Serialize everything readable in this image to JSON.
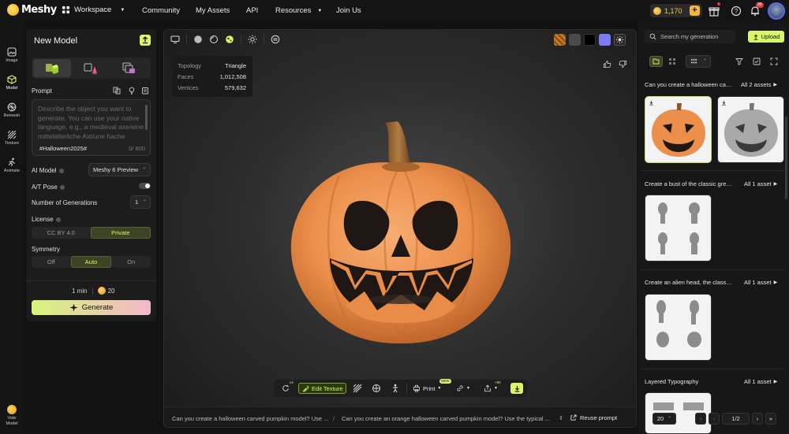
{
  "topbar": {
    "logo": "Meshy",
    "workspace": "Workspace",
    "nav": [
      "Community",
      "My Assets",
      "API",
      "Resources",
      "Join Us"
    ],
    "credits": "1,170",
    "notif_count": "99"
  },
  "leftnav": {
    "items": [
      "Image",
      "Model",
      "Remesh",
      "Texture",
      "Animate"
    ],
    "vote": "Vote Model"
  },
  "panel": {
    "title": "New Model",
    "prompt_label": "Prompt",
    "prompt_placeholder": "Describe the object you want to generate. You can use your native language, e.g., a medieval axe/eine mittelalterliche Axt/une hache",
    "prompt_tag": "#Halloween2025#",
    "prompt_count": "0/ 800",
    "ai_model_label": "AI Model",
    "ai_model_value": "Meshy 6 Preview",
    "at_pose_label": "A/T Pose",
    "num_gen_label": "Number of Generations",
    "num_gen_value": "1",
    "license_label": "License",
    "license_options": [
      "CC BY 4.0",
      "Private"
    ],
    "license_selected": "Private",
    "symmetry_label": "Symmetry",
    "symmetry_options": [
      "Off",
      "Auto",
      "On"
    ],
    "symmetry_selected": "Auto",
    "time": "1 min",
    "cost": "20",
    "generate": "Generate"
  },
  "viewport": {
    "stats": [
      {
        "k": "Topology",
        "v": "Triangle"
      },
      {
        "k": "Faces",
        "v": "1,012,508"
      },
      {
        "k": "Vertices",
        "v": "579,632"
      }
    ],
    "swatch_colors": [
      "#c27a2a",
      "#4a4a4a",
      "#000000",
      "#7c7bf2"
    ],
    "toolbar": {
      "retry_count": "x4",
      "edit_texture": "Edit Texture",
      "print": "Print",
      "print_badge": "NEW",
      "export_count": "+50"
    },
    "history": [
      "Can you create a halloween carved pumpkin model? Use ...",
      "Can you create an orange halloween carved pumpkin model? Use the typical ..."
    ],
    "reuse": "Reuse prompt"
  },
  "rpanel": {
    "search_placeholder": "Search my generation",
    "upload": "Upload",
    "groups": [
      {
        "title": "Can you create a halloween carved pumpkin model?",
        "all": "All 2 assets"
      },
      {
        "title": "Create a bust of the classic grey alien",
        "all": "All 1 asset"
      },
      {
        "title": "Create an alien head, the classic grey alien",
        "all": "All 1 asset"
      },
      {
        "title": "Layered Typography",
        "all": "All 1 asset"
      }
    ],
    "page_size": "20",
    "page": "1/2"
  }
}
